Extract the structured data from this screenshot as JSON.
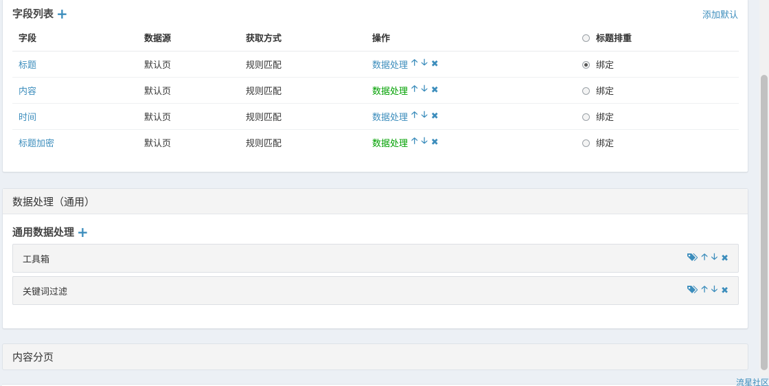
{
  "fields_panel": {
    "title": "字段列表",
    "add_default_label": "添加默认",
    "headers": {
      "field": "字段",
      "source": "数据源",
      "method": "获取方式",
      "operation": "操作",
      "dedupe": "标题排重"
    },
    "rows": [
      {
        "field": "标题",
        "source": "默认页",
        "method": "规则匹配",
        "op_label": "数据处理",
        "op_green": false,
        "bind_label": "绑定",
        "checked": true
      },
      {
        "field": "内容",
        "source": "默认页",
        "method": "规则匹配",
        "op_label": "数据处理",
        "op_green": true,
        "bind_label": "绑定",
        "checked": false
      },
      {
        "field": "时间",
        "source": "默认页",
        "method": "规则匹配",
        "op_label": "数据处理",
        "op_green": false,
        "bind_label": "绑定",
        "checked": false
      },
      {
        "field": "标题加密",
        "source": "默认页",
        "method": "规则匹配",
        "op_label": "数据处理",
        "op_green": true,
        "bind_label": "绑定",
        "checked": false
      }
    ]
  },
  "processing_panel": {
    "header": "数据处理（通用）",
    "section_title": "通用数据处理",
    "items": [
      {
        "label": "工具箱"
      },
      {
        "label": "关键词过滤"
      }
    ]
  },
  "pagination_panel": {
    "header": "内容分页"
  },
  "footer": {
    "link": "流星社区"
  },
  "icons": {
    "add": "plus-icon",
    "up": "arrow-up-icon",
    "down": "arrow-down-icon",
    "remove": "close-icon",
    "tags": "tags-icon"
  },
  "colors": {
    "link": "#3c8dbc",
    "green": "#00a000",
    "background": "#ecf0f5"
  }
}
